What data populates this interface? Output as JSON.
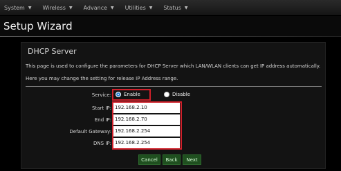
{
  "nav": {
    "items": [
      {
        "label": "System"
      },
      {
        "label": "Wireless"
      },
      {
        "label": "Advance"
      },
      {
        "label": "Utilities"
      },
      {
        "label": "Status"
      }
    ]
  },
  "header": {
    "title": "Setup Wizard"
  },
  "section": {
    "title": "DHCP Server",
    "description": "This page is used to configure the parameters for DHCP Server which LAN/WLAN clients can get IP address automatically. Here you may change the setting for release IP Address range."
  },
  "form": {
    "service": {
      "label": "Service:",
      "options": [
        {
          "label": "Enable",
          "selected": true
        },
        {
          "label": "Disable",
          "selected": false
        }
      ]
    },
    "start_ip": {
      "label": "Start IP:",
      "value": "192.168.2.10"
    },
    "end_ip": {
      "label": "End IP:",
      "value": "192.168.2.70"
    },
    "default_gateway": {
      "label": "Default Gateway:",
      "value": "192.168.2.254"
    },
    "dns_ip": {
      "label": "DNS IP:",
      "value": "192.168.2.254"
    }
  },
  "buttons": {
    "cancel": "Cancel",
    "back": "Back",
    "next": "Next"
  },
  "colors": {
    "highlight_red": "#d0202a",
    "button_green": "#1f4f1f",
    "radio_selected": "#2a7fd1"
  }
}
